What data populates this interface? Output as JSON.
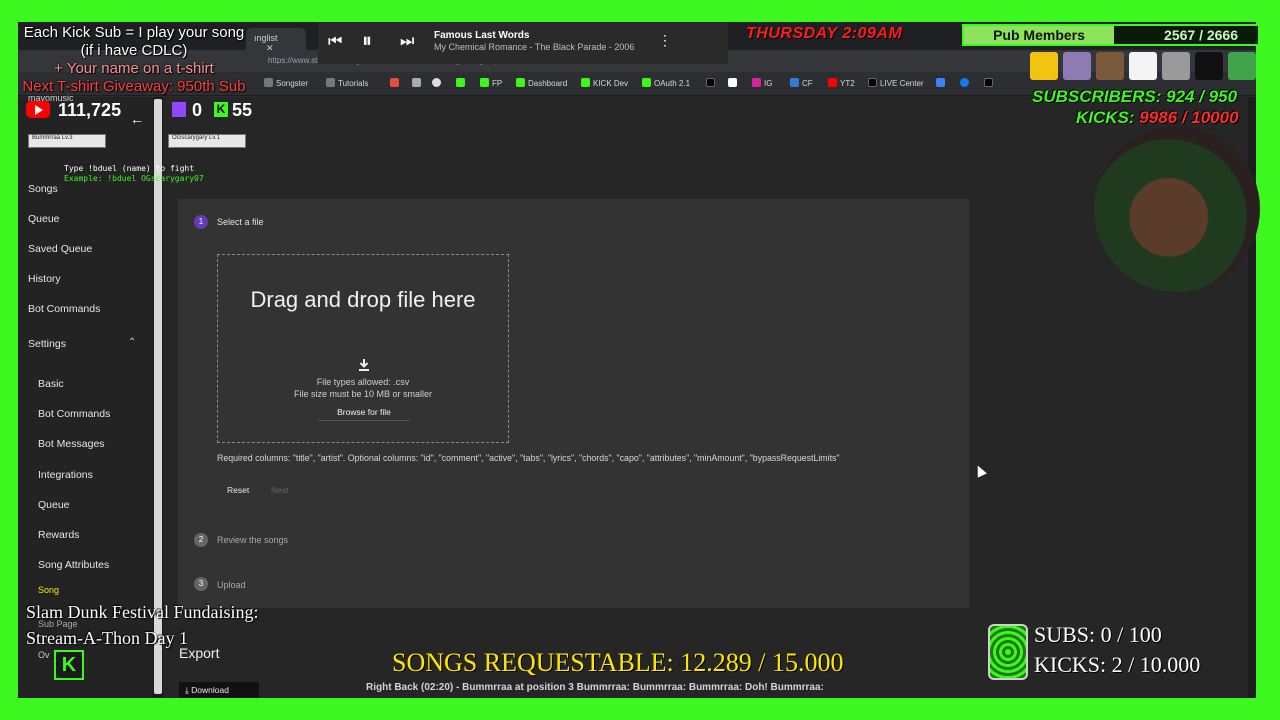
{
  "browser": {
    "tabs": [
      "ınglist"
    ],
    "url": "https://www.streamersonglist.com/t/mavomusic/settings/song-import",
    "bookmarks": [
      "Songster",
      "Tutorials",
      "",
      "",
      "FP",
      "Dashboard",
      "KICK Dev",
      "OAuth 2.1",
      "",
      "",
      "IG",
      "CF",
      "YT2",
      "LIVE Center",
      "",
      "",
      ""
    ]
  },
  "sidebar": {
    "brand": "mavomusic",
    "items": [
      "Songs",
      "Queue",
      "Saved Queue",
      "History",
      "Bot Commands"
    ],
    "settings_label": "Settings",
    "settings_items": [
      "Basic",
      "Bot Commands",
      "Bot Messages",
      "Integrations",
      "Queue",
      "Rewards",
      "Song Attributes",
      "Song",
      "Sub Page",
      "Ov"
    ]
  },
  "import": {
    "step1": {
      "num": "1",
      "label": "Select a file"
    },
    "dropzone": {
      "title": "Drag and drop file here",
      "types": "File types allowed: .csv",
      "size": "File size must be 10 MB or smaller",
      "browse": "Browse for file"
    },
    "required": "Required columns: \"title\", \"artist\". Optional columns: \"id\", \"comment\", \"active\", \"tabs\", \"lyrics\", \"chords\", \"capo\", \"attributes\", \"minAmount\", \"bypassRequestLimits\"",
    "reset": "Reset",
    "next": "Next",
    "step2": {
      "num": "2",
      "label": "Review the songs"
    },
    "step3": {
      "num": "3",
      "label": "Upload"
    }
  },
  "export": {
    "title": "Export",
    "download": "Download"
  },
  "overlay": {
    "promo": [
      "Each Kick Sub = I play your song",
      "(if i have CDLC)",
      "+ Your name on a t-shirt",
      "Next T-shirt Giveaway: 950th Sub"
    ],
    "youtube_count": "111,725",
    "twitch_count": "0",
    "kick_count": "55",
    "now_playing_title": "Famous Last Words",
    "now_playing_artist": "My Chemical Romance - The Black Parade - 2006",
    "clock": "THURSDAY 2:09AM",
    "pub_label": "Pub Members",
    "pub_count": "2567 / 2666",
    "subscribers": "SUBSCRIBERS: 924 / 950",
    "kicks_label": "KICKS: ",
    "kicks_value": "9986 / 10000",
    "duel_left": "Bummrraa  Lv.3",
    "duel_right": "OGscarygary  Lv.1",
    "duel_help": "Type !bduel (name) to fight",
    "duel_example": "Example: !bduel OGscarygary07",
    "fund_line1": "Slam Dunk Festival Fundaising:",
    "fund_line2": "Stream-A-Thon Day 1",
    "songs_requestable": "SONGS REQUESTABLE: 12.289 / 15.000",
    "ticker": "Right Back (02:20) - Bummrraa at position 3  Bummrraa:  Bummrraa:  Bummrraa: Doh!  Bummrraa:",
    "subs_goal": "SUBS:  0 / 100",
    "kicks_goal": "KICKS: 2 / 10.000"
  },
  "colors": {
    "accent": "#3cf81e",
    "step_active": "#673ab7",
    "red": "#ff1b1b",
    "yellow": "#ffe600"
  }
}
